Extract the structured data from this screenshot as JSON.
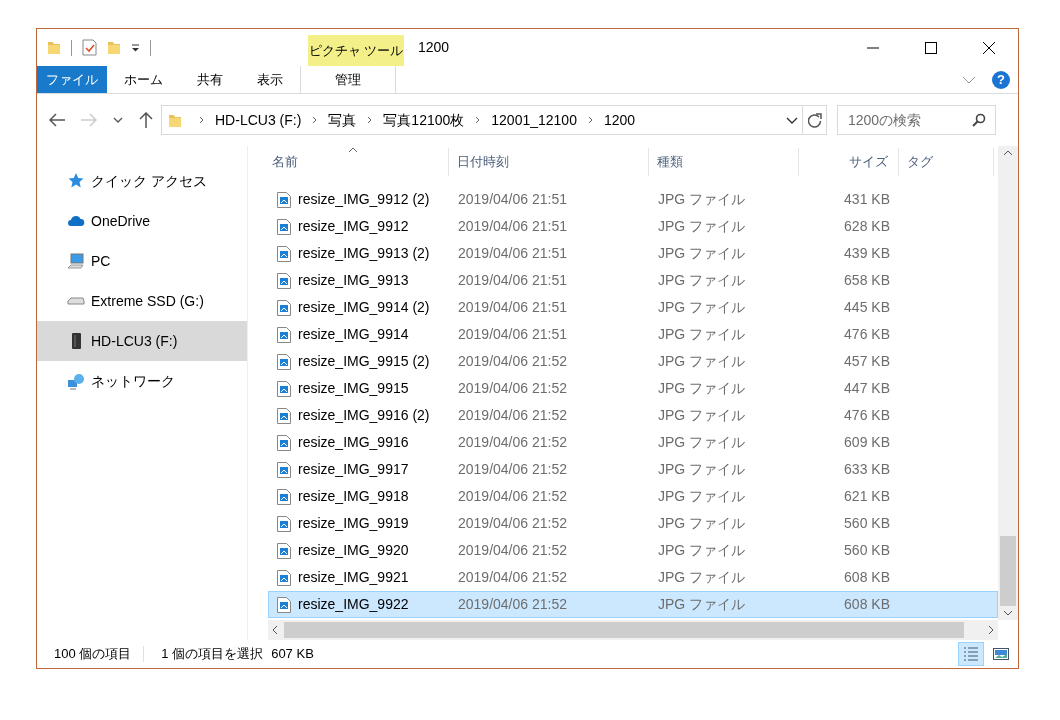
{
  "window": {
    "title": "1200"
  },
  "contextual_tab_group": {
    "label": "ピクチャ ツール"
  },
  "ribbon_tabs": [
    {
      "label": "ファイル",
      "kind": "file"
    },
    {
      "label": "ホーム",
      "kind": "normal"
    },
    {
      "label": "共有",
      "kind": "normal"
    },
    {
      "label": "表示",
      "kind": "normal"
    },
    {
      "label": "管理",
      "kind": "contextual"
    }
  ],
  "help_button": {
    "label": "?"
  },
  "address_bar": {
    "segments": [
      "HD-LCU3 (F:)",
      "写真",
      "写真12100枚",
      "12001_12100",
      "1200"
    ]
  },
  "search": {
    "placeholder": "1200の検索"
  },
  "nav_pane": {
    "items": [
      {
        "label": "クイック アクセス",
        "kind": "star",
        "selected": false
      },
      {
        "label": "OneDrive",
        "kind": "cloud",
        "selected": false
      },
      {
        "label": "PC",
        "kind": "computer",
        "selected": false
      },
      {
        "label": "Extreme SSD (G:)",
        "kind": "drive",
        "selected": false
      },
      {
        "label": "HD-LCU3 (F:)",
        "kind": "external-drive",
        "selected": true
      },
      {
        "label": "ネットワーク",
        "kind": "network",
        "selected": false
      }
    ]
  },
  "file_list": {
    "columns": [
      {
        "label": "名前",
        "sorted": true
      },
      {
        "label": "日付時刻",
        "sorted": false
      },
      {
        "label": "種類",
        "sorted": false
      },
      {
        "label": "サイズ",
        "sorted": false
      },
      {
        "label": "タグ",
        "sorted": false
      }
    ],
    "rows": [
      {
        "name": "resize_IMG_9912 (2)",
        "date": "2019/04/06 21:51",
        "type": "JPG ファイル",
        "size": "431 KB",
        "selected": false
      },
      {
        "name": "resize_IMG_9912",
        "date": "2019/04/06 21:51",
        "type": "JPG ファイル",
        "size": "628 KB",
        "selected": false
      },
      {
        "name": "resize_IMG_9913 (2)",
        "date": "2019/04/06 21:51",
        "type": "JPG ファイル",
        "size": "439 KB",
        "selected": false
      },
      {
        "name": "resize_IMG_9913",
        "date": "2019/04/06 21:51",
        "type": "JPG ファイル",
        "size": "658 KB",
        "selected": false
      },
      {
        "name": "resize_IMG_9914 (2)",
        "date": "2019/04/06 21:51",
        "type": "JPG ファイル",
        "size": "445 KB",
        "selected": false
      },
      {
        "name": "resize_IMG_9914",
        "date": "2019/04/06 21:51",
        "type": "JPG ファイル",
        "size": "476 KB",
        "selected": false
      },
      {
        "name": "resize_IMG_9915 (2)",
        "date": "2019/04/06 21:52",
        "type": "JPG ファイル",
        "size": "457 KB",
        "selected": false
      },
      {
        "name": "resize_IMG_9915",
        "date": "2019/04/06 21:52",
        "type": "JPG ファイル",
        "size": "447 KB",
        "selected": false
      },
      {
        "name": "resize_IMG_9916 (2)",
        "date": "2019/04/06 21:52",
        "type": "JPG ファイル",
        "size": "476 KB",
        "selected": false
      },
      {
        "name": "resize_IMG_9916",
        "date": "2019/04/06 21:52",
        "type": "JPG ファイル",
        "size": "609 KB",
        "selected": false
      },
      {
        "name": "resize_IMG_9917",
        "date": "2019/04/06 21:52",
        "type": "JPG ファイル",
        "size": "633 KB",
        "selected": false
      },
      {
        "name": "resize_IMG_9918",
        "date": "2019/04/06 21:52",
        "type": "JPG ファイル",
        "size": "621 KB",
        "selected": false
      },
      {
        "name": "resize_IMG_9919",
        "date": "2019/04/06 21:52",
        "type": "JPG ファイル",
        "size": "560 KB",
        "selected": false
      },
      {
        "name": "resize_IMG_9920",
        "date": "2019/04/06 21:52",
        "type": "JPG ファイル",
        "size": "560 KB",
        "selected": false
      },
      {
        "name": "resize_IMG_9921",
        "date": "2019/04/06 21:52",
        "type": "JPG ファイル",
        "size": "608 KB",
        "selected": false
      },
      {
        "name": "resize_IMG_9922",
        "date": "2019/04/06 21:52",
        "type": "JPG ファイル",
        "size": "608 KB",
        "selected": true
      }
    ]
  },
  "status_bar": {
    "item_count": "100 個の項目",
    "selection": "1 個の項目を選択",
    "selection_size": "607 KB"
  },
  "view_buttons": [
    {
      "kind": "details",
      "selected": true
    },
    {
      "kind": "large-icons",
      "selected": false
    }
  ]
}
